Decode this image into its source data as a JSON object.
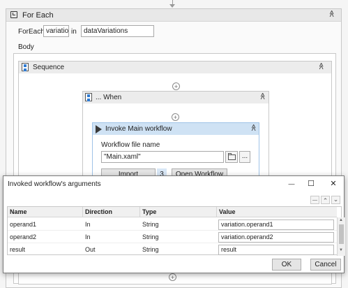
{
  "foreach": {
    "title": "For Each",
    "foreach_label": "ForEach",
    "item_value": "variation",
    "in_label": "in",
    "collection_value": "dataVariations",
    "body_label": "Body"
  },
  "sequence": {
    "title": "Sequence"
  },
  "when": {
    "title": "... When"
  },
  "invoke": {
    "title": "Invoke Main workflow",
    "file_label": "Workflow file name",
    "file_value": "\"Main.xaml\"",
    "browse_label": "...",
    "import_label": "Import Arguments",
    "import_count": "3",
    "open_label": "Open Workflow"
  },
  "dialog": {
    "title": "Invoked workflow's arguments",
    "columns": [
      "Name",
      "Direction",
      "Type",
      "Value"
    ],
    "rows": [
      {
        "name": "operand1",
        "direction": "In",
        "type": "String",
        "value": "variation.operand1"
      },
      {
        "name": "operand2",
        "direction": "In",
        "type": "String",
        "value": "variation.operand2"
      },
      {
        "name": "result",
        "direction": "Out",
        "type": "String",
        "value": "result"
      }
    ],
    "ok_label": "OK",
    "cancel_label": "Cancel"
  },
  "glyphs": {
    "collapse": "≪",
    "add": "+",
    "minimize": "—",
    "maximize": "☐",
    "close": "✕",
    "remove": "—",
    "up": "⌃",
    "down": "⌄",
    "scroll_up": "▲",
    "scroll_down": "▼"
  },
  "colors": {
    "accent": "#2f7bd2",
    "invoke_header": "#cfe2f4",
    "count_bg": "#d8e7f6"
  }
}
